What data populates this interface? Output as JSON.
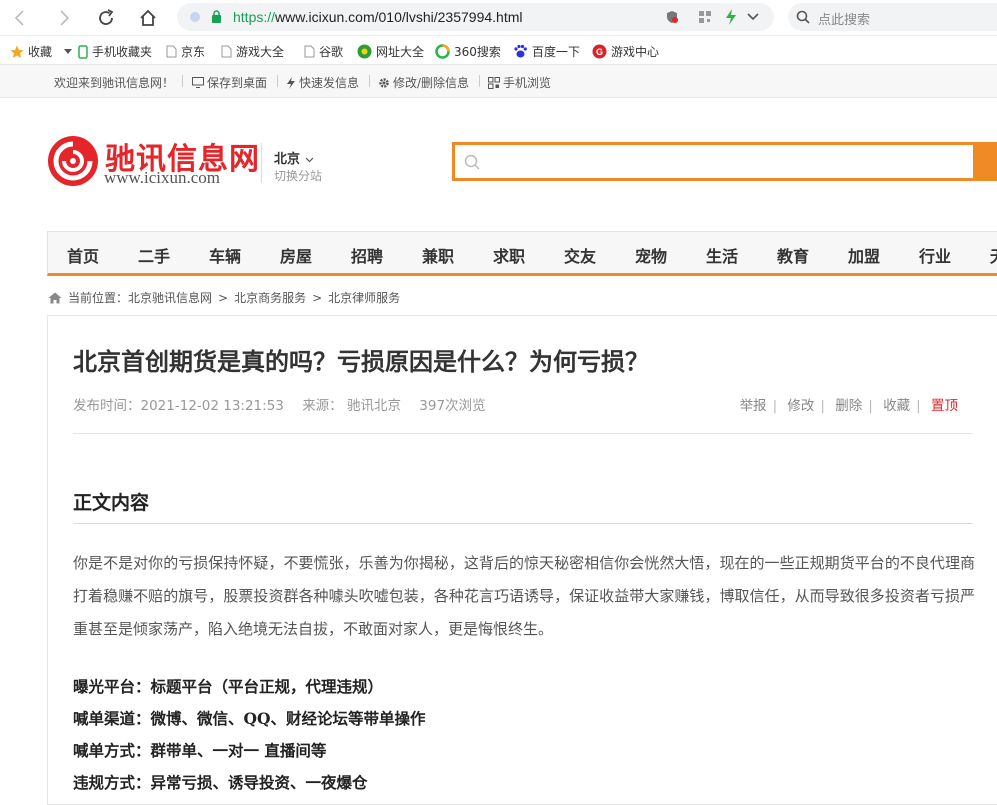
{
  "browser": {
    "url_protocol": "https://",
    "url_rest": "www.icixun.com/010/lvshi/2357994.html",
    "search_placeholder": "点此搜索"
  },
  "bookmarks": [
    "收藏",
    "手机收藏夹",
    "京东",
    "游戏大全",
    "谷歌",
    "网址大全",
    "360搜索",
    "百度一下",
    "游戏中心"
  ],
  "site_top": {
    "welcome": "欢迎来到驰讯信息网！",
    "save_desktop": "保存到桌面",
    "quick_post": "快速发信息",
    "edit_delete": "修改/删除信息",
    "mobile": "手机浏览"
  },
  "header": {
    "logo_name": "驰讯信息网",
    "logo_url": "www.icixun.com",
    "city": "北京",
    "city_switch": "切换分站"
  },
  "nav": [
    "首页",
    "二手",
    "车辆",
    "房屋",
    "招聘",
    "兼职",
    "求职",
    "交友",
    "宠物",
    "生活",
    "教育",
    "加盟",
    "行业",
    "无"
  ],
  "breadcrumb": {
    "prefix": "当前位置：",
    "items": [
      "北京驰讯信息网",
      "北京商务服务",
      "北京律师服务"
    ],
    "separator": ">"
  },
  "article": {
    "title": "北京首创期货是真的吗？亏损原因是什么？为何亏损？",
    "publish_time": "发布时间：2021-12-02 13:21:53",
    "source": "来源： 驰讯北京",
    "views": "397次浏览",
    "actions": [
      "举报",
      "修改",
      "删除",
      "收藏",
      "置顶"
    ],
    "section_title": "正文内容",
    "paragraph": "你是不是对你的亏损保持怀疑，不要慌张，乐善为你揭秘，这背后的惊天秘密相信你会恍然大悟，现在的一些正规期货平台的不良代理商打着稳赚不赔的旗号，股票投资群各种噱头吹嘘包装，各种花言巧语诱导，保证收益带大家赚钱，博取信任，从而导致很多投资者亏损严重甚至是倾家荡产，陷入绝境无法自拔，不敢面对家人，更是悔恨终生。",
    "lines": [
      "曝光平台：标题平台（平台正规，代理违规）",
      "喊单渠道：微博、微信、QQ、财经论坛等带单操作",
      "喊单方式：群带单、一对一 直播间等",
      "违规方式：异常亏损、诱导投资、一夜爆仓"
    ]
  },
  "colors": {
    "brand_red": "#e4262a",
    "accent_orange": "#f08a24"
  }
}
